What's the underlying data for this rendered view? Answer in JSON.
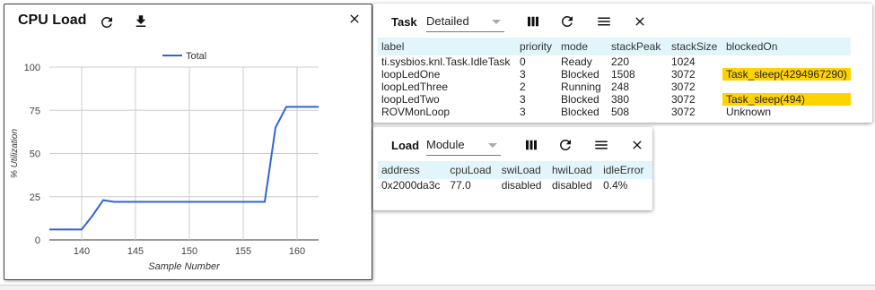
{
  "cpu_panel": {
    "title": "CPU Load",
    "icons": [
      "refresh-icon",
      "download-icon",
      "close-icon"
    ]
  },
  "chart_data": {
    "type": "line",
    "title": "",
    "xlabel": "Sample Number",
    "ylabel": "% Utilization",
    "xlim": [
      137,
      162
    ],
    "ylim": [
      0,
      100
    ],
    "x_ticks": [
      "140",
      "145",
      "150",
      "155",
      "160"
    ],
    "y_ticks": [
      "0",
      "25",
      "50",
      "75",
      "100"
    ],
    "grid": true,
    "legend": "top",
    "series": [
      {
        "name": "Total",
        "color": "#3366cc",
        "x": [
          137,
          138,
          139,
          140,
          141,
          142,
          143,
          144,
          145,
          146,
          147,
          148,
          149,
          150,
          151,
          152,
          153,
          154,
          155,
          156,
          157,
          158,
          159,
          160,
          161,
          162
        ],
        "y": [
          6,
          6,
          6,
          6,
          14,
          23,
          22,
          22,
          22,
          22,
          22,
          22,
          22,
          22,
          22,
          22,
          22,
          22,
          22,
          22,
          22,
          65,
          77,
          77,
          77,
          77
        ]
      }
    ]
  },
  "task_panel": {
    "label": "Task",
    "select_value": "Detailed",
    "columns": [
      "label",
      "priority",
      "mode",
      "stackPeak",
      "stackSize",
      "blockedOn"
    ],
    "rows": [
      [
        "ti.sysbios.knl.Task.IdleTask",
        "0",
        "Ready",
        "220",
        "1024",
        ""
      ],
      [
        "loopLedOne",
        "3",
        "Blocked",
        "1508",
        "3072",
        "Task_sleep(4294967290)"
      ],
      [
        "loopLedThree",
        "2",
        "Running",
        "248",
        "3072",
        ""
      ],
      [
        "loopLedTwo",
        "3",
        "Blocked",
        "380",
        "3072",
        "Task_sleep(494)"
      ],
      [
        "ROVMonLoop",
        "3",
        "Blocked",
        "508",
        "3072",
        "Unknown"
      ]
    ],
    "highlight_color": "#ffd300"
  },
  "load_panel": {
    "label": "Load",
    "select_value": "Module",
    "columns": [
      "address",
      "cpuLoad",
      "swiLoad",
      "hwiLoad",
      "idleError"
    ],
    "rows": [
      [
        "0x2000da3c",
        "77.0",
        "disabled",
        "disabled",
        "0.4%"
      ]
    ]
  }
}
